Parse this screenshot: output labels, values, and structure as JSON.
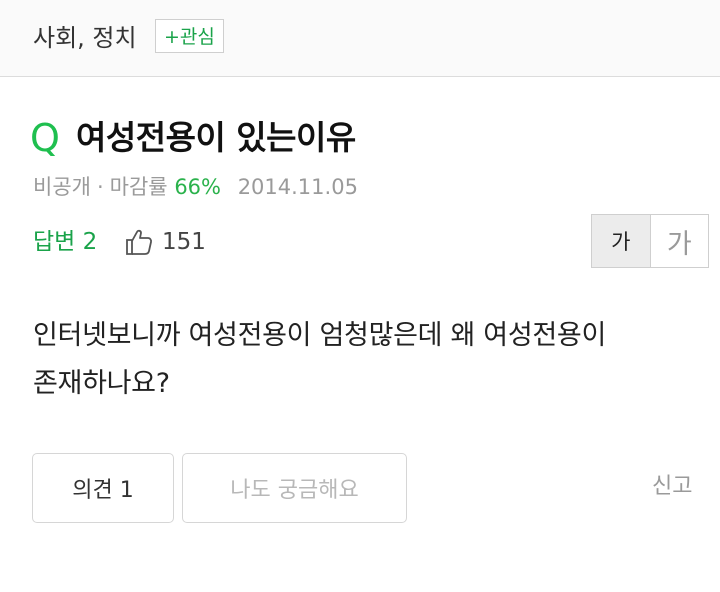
{
  "header": {
    "category": "사회, 정치",
    "interest_label": "+관심"
  },
  "question": {
    "q_mark": "Q",
    "title": "여성전용이 있는이유",
    "visibility": "비공개",
    "separator": "·",
    "deadline_label": "마감률",
    "deadline_rate": "66%",
    "date": "2014.11.05",
    "answers_label": "답변 2",
    "likes_count": "151",
    "body_line1": "인터넷보니까 여성전용이 엄청많은데 왜 여성전용이",
    "body_line2": "존재하나요?"
  },
  "font_size": {
    "small_label": "가",
    "large_label": "가"
  },
  "actions": {
    "opinion_label": "의견 1",
    "curious_label": "나도 궁금해요",
    "report_label": "신고"
  },
  "colors": {
    "accent_green": "#1aa34a",
    "q_green": "#1fbf4f",
    "meta_gray": "#9a9a9a"
  }
}
